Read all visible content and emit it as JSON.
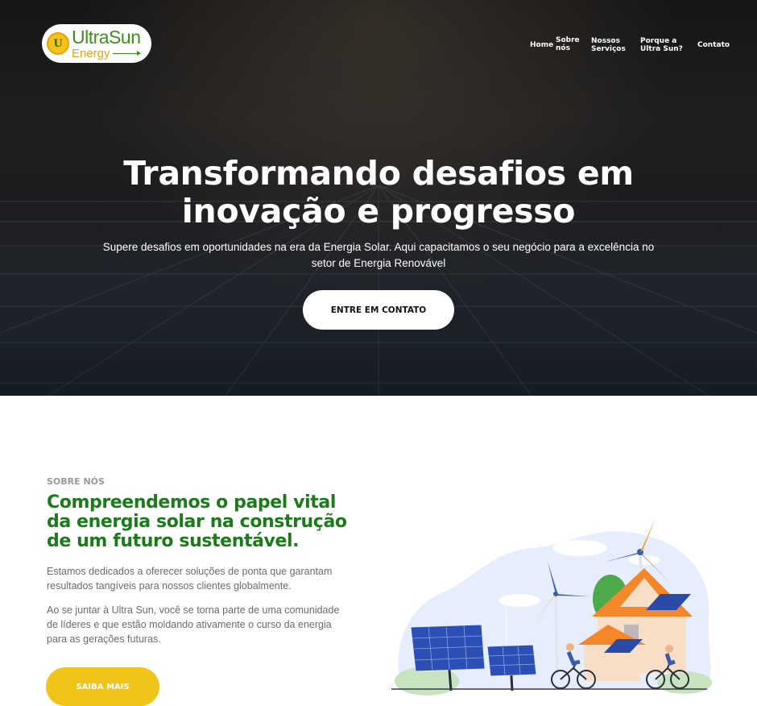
{
  "logo": {
    "mark": "U",
    "line1": "UltraSun",
    "line2": "Energy"
  },
  "nav": {
    "home": "Home",
    "sobre_line1": "Sobre",
    "sobre_line2": "nós",
    "servicos_line1": "Nossos",
    "servicos_line2": "Serviços",
    "porque_line1": "Porque a",
    "porque_line2": "Ultra Sun?",
    "contato": "Contato"
  },
  "hero": {
    "title_line1": "Transformando desafios em",
    "title_line2": "inovação e progresso",
    "subtitle_line1": "Supere desafios em oportunidades na era da Energia Solar. Aqui capacitamos o seu negócio para a excelência no",
    "subtitle_line2": "setor de Energia Renovável",
    "cta": "ENTRE EM CONTATO"
  },
  "about": {
    "kicker": "SOBRE NÓS",
    "title_line1": "Compreendemos o papel vital",
    "title_line2": "da energia solar na construção",
    "title_line3": "de um futuro sustentável.",
    "p1_line1": "Estamos dedicados a oferecer soluções de ponta que garantam",
    "p1_line2": "resultados tangíveis para nossos clientes globalmente.",
    "p2_line1": "Ao se juntar à Ultra Sun, você se torna parte de uma comunidade",
    "p2_line2": "de líderes e que estão moldando ativamente o curso da energia",
    "p2_line3": "para as gerações futuras.",
    "cta": "SAIBA MAIS"
  },
  "colors": {
    "brand_green": "#1c7a1c",
    "brand_yellow": "#f0c419",
    "hero_bg": "#1b1a1a",
    "text_gray": "#6b6b6b"
  },
  "icons": [
    "sun-logo-icon",
    "arrow-icon",
    "solar-panel-icon",
    "wind-turbine-icon",
    "house-icon",
    "cyclist-icon"
  ]
}
